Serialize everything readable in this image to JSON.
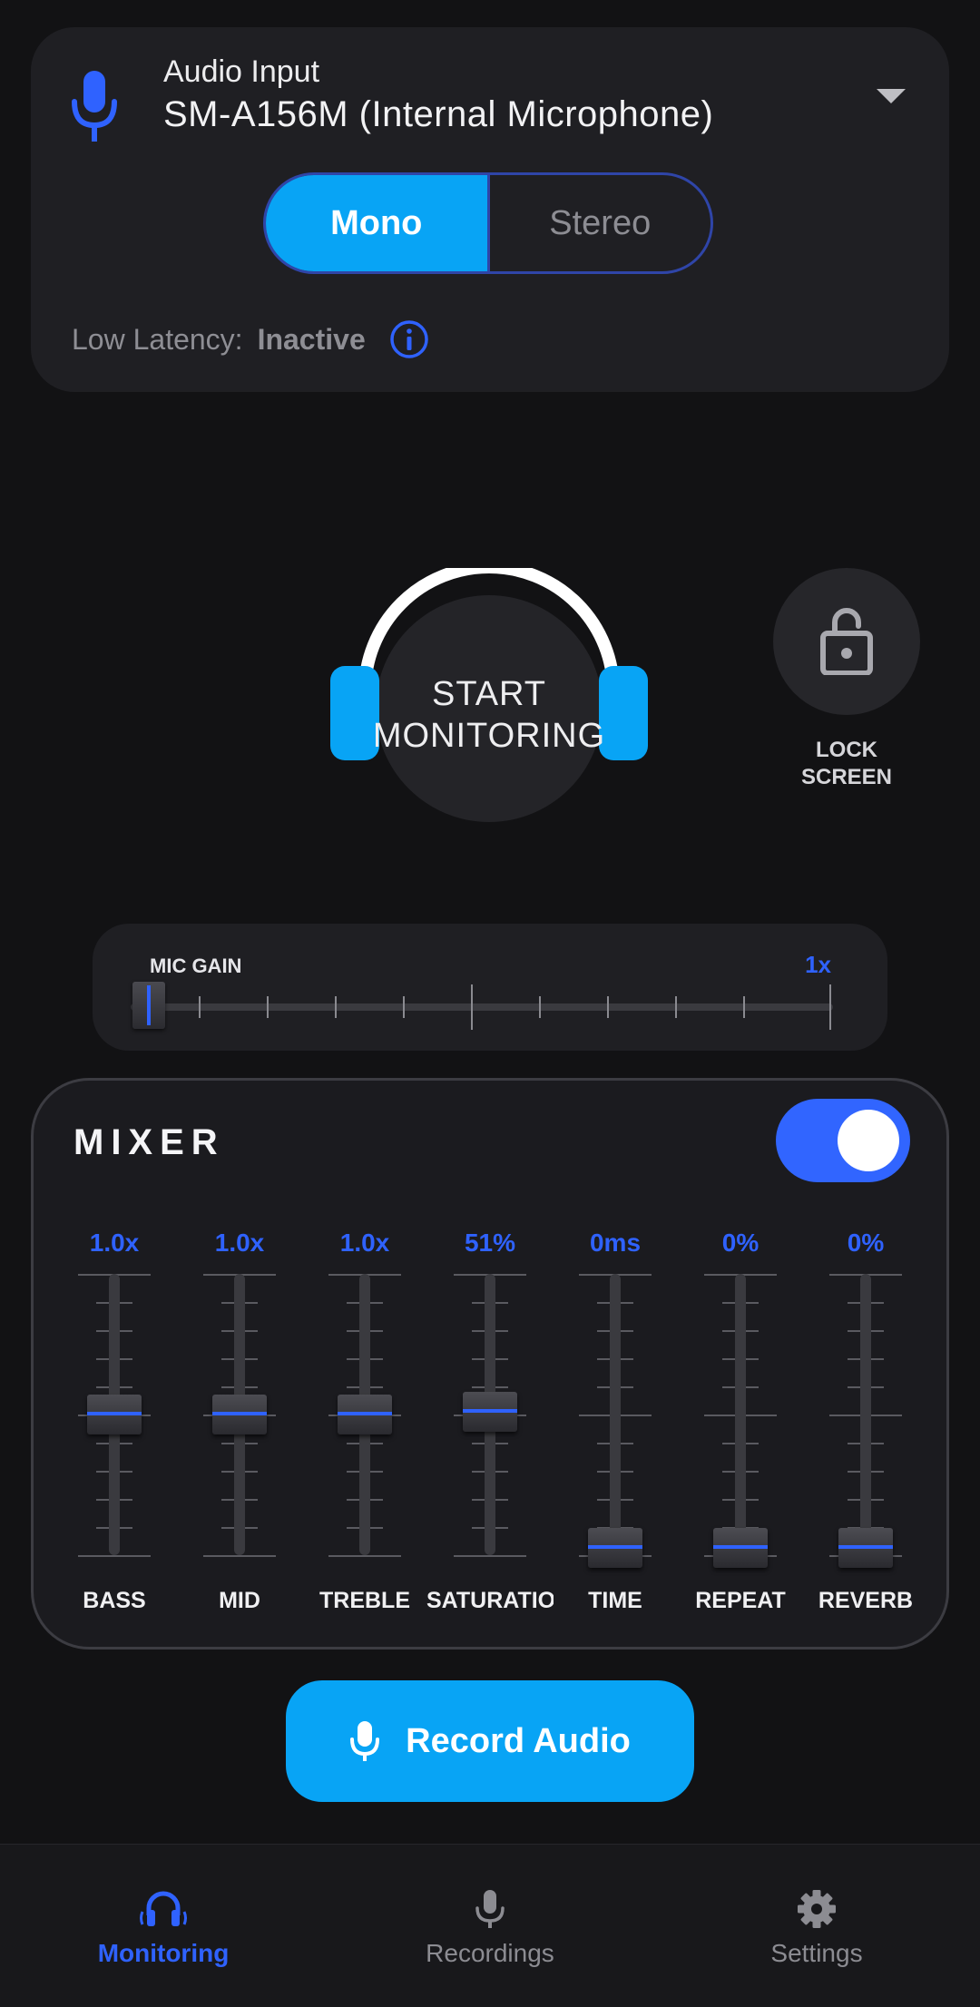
{
  "audio_input": {
    "label": "Audio Input",
    "device": "SM-A156M (Internal Microphone)",
    "channel_mode": {
      "options": [
        "Mono",
        "Stereo"
      ],
      "selected": "Mono"
    },
    "low_latency_label": "Low Latency:",
    "low_latency_status": "Inactive"
  },
  "monitor": {
    "button_line1": "START",
    "button_line2": "MONITORING",
    "lock_line1": "LOCK",
    "lock_line2": "SCREEN"
  },
  "mic_gain": {
    "label": "MIC GAIN",
    "value": "1x",
    "position_fraction": 0.0
  },
  "mixer": {
    "title": "MIXER",
    "enabled": true,
    "faders": [
      {
        "label": "BASS",
        "value": "1.0x",
        "level": 0.5
      },
      {
        "label": "MID",
        "value": "1.0x",
        "level": 0.5
      },
      {
        "label": "TREBLE",
        "value": "1.0x",
        "level": 0.5
      },
      {
        "label": "SATURATION",
        "value": "51%",
        "level": 0.51
      },
      {
        "label": "TIME",
        "value": "0ms",
        "level": 0.0
      },
      {
        "label": "REPEAT",
        "value": "0%",
        "level": 0.0
      },
      {
        "label": "REVERB",
        "value": "0%",
        "level": 0.0
      }
    ]
  },
  "record": {
    "label": "Record Audio"
  },
  "nav": {
    "items": [
      {
        "label": "Monitoring",
        "icon": "headphones-icon",
        "active": true
      },
      {
        "label": "Recordings",
        "icon": "microphone-icon",
        "active": false
      },
      {
        "label": "Settings",
        "icon": "gear-icon",
        "active": false
      }
    ]
  },
  "colors": {
    "accent_blue": "#2f62ff",
    "accent_cyan": "#08a4f5",
    "background": "#121214",
    "card": "#1f1f23"
  }
}
